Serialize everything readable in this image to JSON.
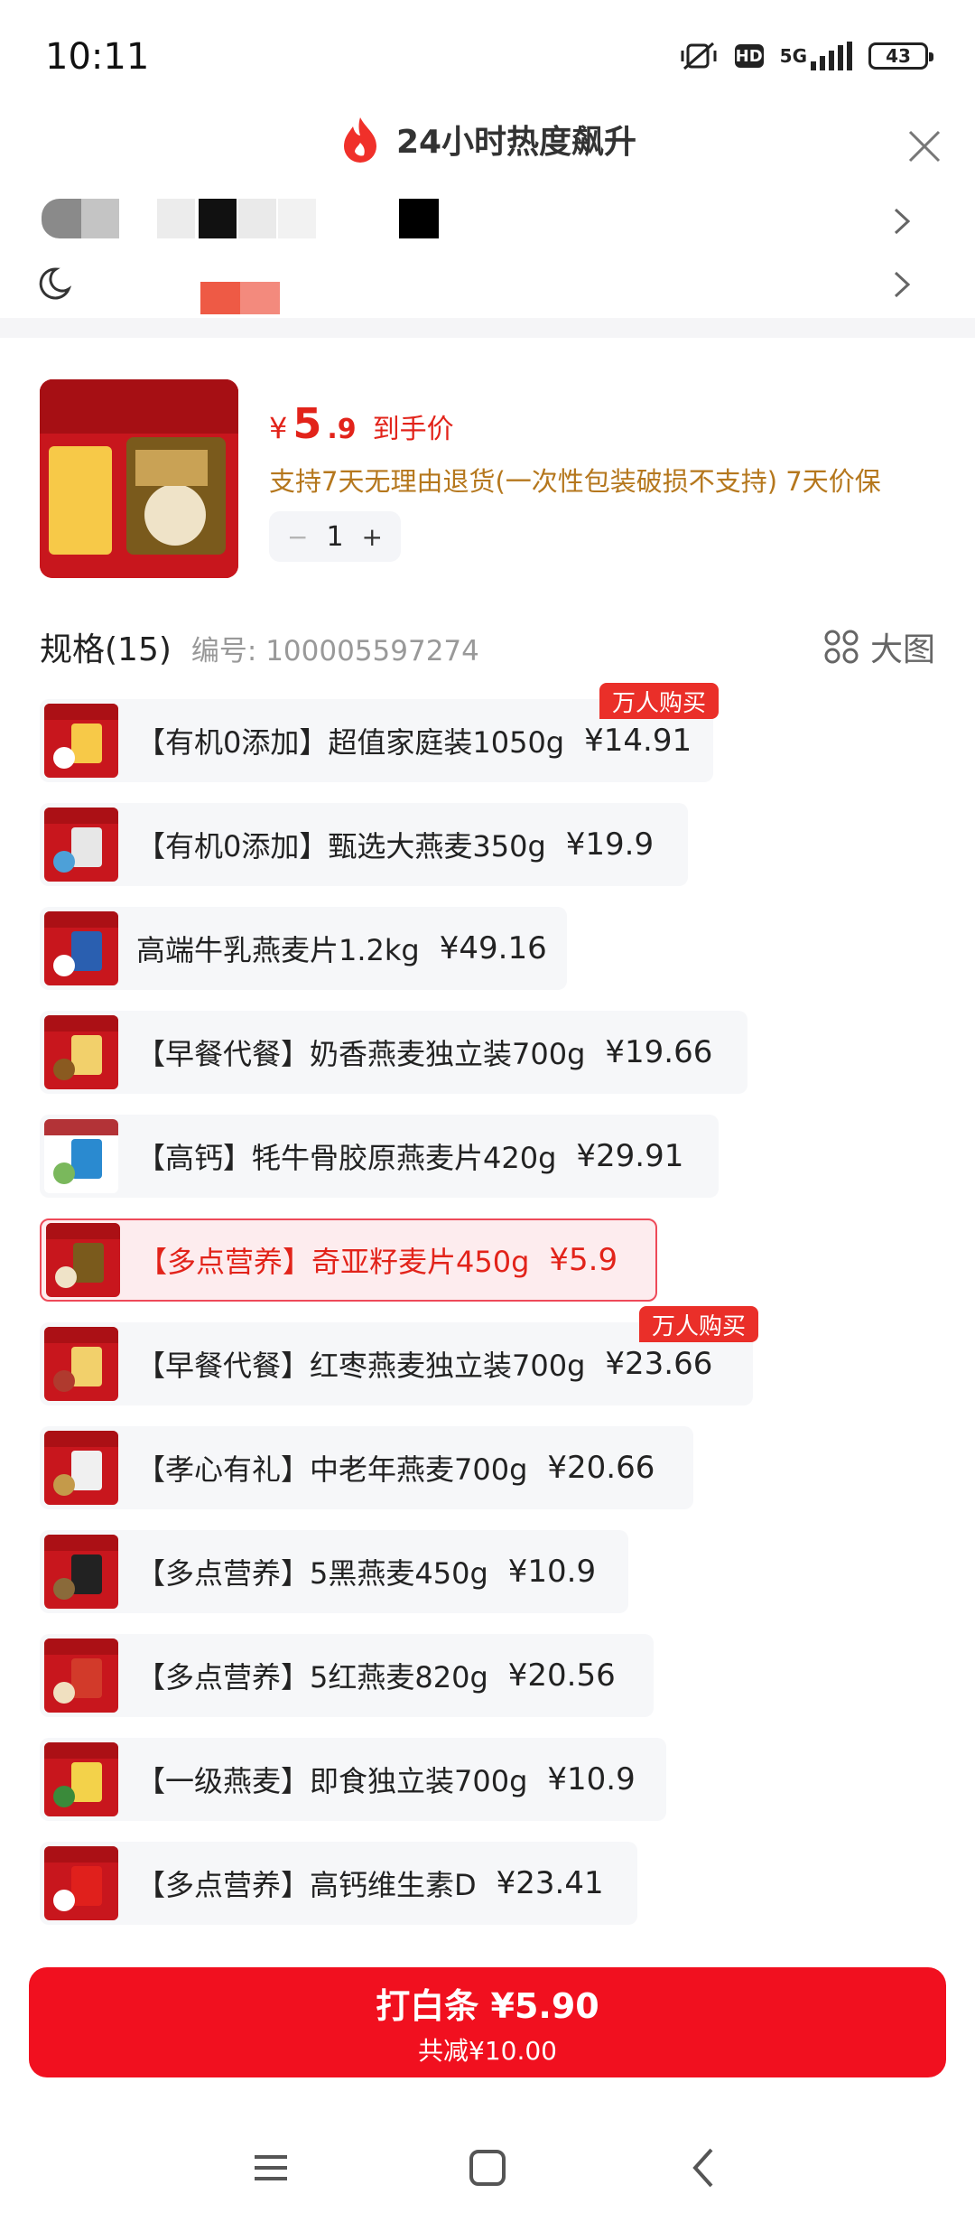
{
  "status_bar": {
    "time": "10:11",
    "network": "5G",
    "hd": "HD",
    "battery": "43"
  },
  "header": {
    "title": "24小时热度飙升"
  },
  "product": {
    "price_yen": "¥",
    "price_int": "5",
    "price_dec": ".9",
    "price_label": "到手价",
    "service": "支持7天无理由退货(一次性包装破损不支持) 7天价保",
    "quantity": "1",
    "minus": "−",
    "plus": "+"
  },
  "spec": {
    "title": "规格(15)",
    "code": "编号: 100005597274",
    "big_image_label": "大图"
  },
  "spec_items": [
    {
      "label": "【有机0添加】超值家庭装1050g",
      "price": "¥14.91",
      "tag": "万人购买",
      "selected": false
    },
    {
      "label": "【有机0添加】甄选大燕麦350g",
      "price": "¥19.9",
      "tag": "",
      "selected": false
    },
    {
      "label": "高端牛乳燕麦片1.2kg",
      "price": "¥49.16",
      "tag": "",
      "selected": false
    },
    {
      "label": "【早餐代餐】奶香燕麦独立装700g",
      "price": "¥19.66",
      "tag": "",
      "selected": false
    },
    {
      "label": "【高钙】牦牛骨胶原燕麦片420g",
      "price": "¥29.91",
      "tag": "",
      "selected": false
    },
    {
      "label": "【多点营养】奇亚籽麦片450g",
      "price": "¥5.9",
      "tag": "",
      "selected": true
    },
    {
      "label": "【早餐代餐】红枣燕麦独立装700g",
      "price": "¥23.66",
      "tag": "万人购买",
      "selected": false
    },
    {
      "label": "【孝心有礼】中老年燕麦700g",
      "price": "¥20.66",
      "tag": "",
      "selected": false
    },
    {
      "label": "【多点营养】5黑燕麦450g",
      "price": "¥10.9",
      "tag": "",
      "selected": false
    },
    {
      "label": "【多点营养】5红燕麦820g",
      "price": "¥20.56",
      "tag": "",
      "selected": false
    },
    {
      "label": "【一级燕麦】即食独立装700g",
      "price": "¥10.9",
      "tag": "",
      "selected": false
    },
    {
      "label": "【多点营养】高钙维生素D",
      "price": "¥23.41",
      "tag": "",
      "selected": false
    }
  ],
  "buy": {
    "label": "打白条 ¥5.90",
    "sub": "共减¥10.00"
  },
  "colors": {
    "accent": "#f1101f",
    "price_red": "#e2231a",
    "service_brown": "#b5771d"
  }
}
